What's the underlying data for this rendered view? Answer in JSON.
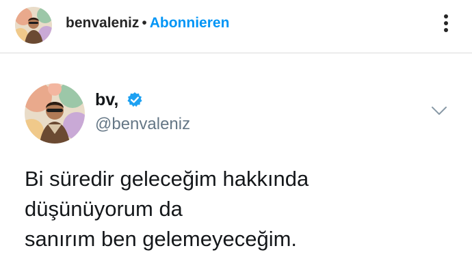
{
  "post_header": {
    "username": "benvaleniz",
    "separator": "•",
    "follow_label": "Abonnieren",
    "more_icon": "more-vertical-icon"
  },
  "tweet": {
    "display_name": "bv,",
    "verified_icon": "verified-badge-icon",
    "handle": "@benvaleniz",
    "chevron_icon": "chevron-down-icon",
    "lines": [
      "Bi süredir geleceğim hakkında",
      "düşünüyorum da",
      "sanırım ben gelemeyeceğim."
    ]
  },
  "colors": {
    "follow": "#0095f6",
    "verified": "#1da1f2",
    "handle": "#657786",
    "text": "#14171a"
  }
}
